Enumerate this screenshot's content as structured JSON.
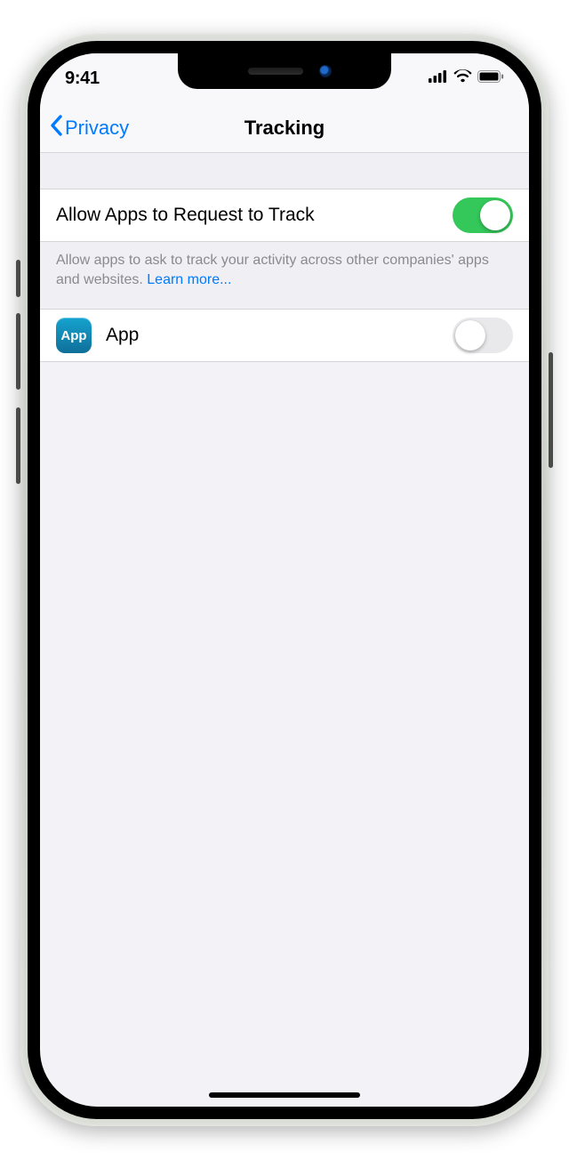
{
  "status_bar": {
    "time": "9:41"
  },
  "nav": {
    "back_label": "Privacy",
    "title": "Tracking"
  },
  "settings": {
    "allow_request_label": "Allow Apps to Request to Track",
    "allow_request_on": true,
    "description": "Allow apps to ask to track your activity across other companies' apps and websites. ",
    "learn_more_label": "Learn more...",
    "apps": [
      {
        "icon_text": "App",
        "name": "App",
        "tracking_on": false
      }
    ]
  }
}
